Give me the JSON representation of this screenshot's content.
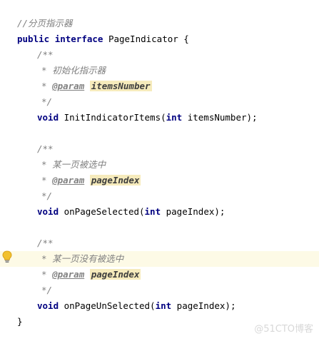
{
  "lines": {
    "l1": "//分页指示器",
    "l2_kw1": "public",
    "l2_kw2": "interface",
    "l2_rest": " PageIndicator {",
    "doc_open": "/**",
    "doc_close": "*/",
    "star": "* ",
    "param_tag": "@param",
    "m1_desc": "初始化指示器",
    "m1_param": "itemsNumber",
    "m1_void": "void",
    "m1_name": " InitIndicatorItems(",
    "m1_int": "int",
    "m1_tail": " itemsNumber);",
    "m2_desc": "某一页被选中",
    "m2_param": "pageIndex",
    "m2_void": "void",
    "m2_name": " onPageSelected(",
    "m2_int": "int",
    "m2_tail": " pageIndex);",
    "m3_desc": "某一页没有被选中",
    "m3_param": "pageIndex",
    "m3_void": "void",
    "m3_name": " onPageUnSelected(",
    "m3_int": "int",
    "m3_tail": " pageIndex);",
    "close_brace": "}"
  },
  "gutter": {
    "intention_icon": "lightbulb-icon"
  },
  "watermark": "@51CTO博客",
  "colors": {
    "keyword": "#000080",
    "comment": "#808080",
    "param_highlight": "#f6ebbc",
    "caret_line": "#fdfae6",
    "bulb": "#f2c12e"
  }
}
